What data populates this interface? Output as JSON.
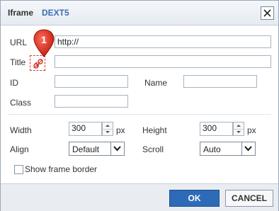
{
  "dialog": {
    "title": "Iframe",
    "brand": "DEXT5"
  },
  "fields": {
    "url_label": "URL",
    "url_value": "http://",
    "title_label": "Title",
    "title_value": "",
    "id_label": "ID",
    "id_value": "",
    "name_label": "Name",
    "name_value": "",
    "class_label": "Class",
    "class_value": ""
  },
  "layout_fields": {
    "width_label": "Width",
    "width_value": "300",
    "width_unit": "px",
    "height_label": "Height",
    "height_value": "300",
    "height_unit": "px",
    "align_label": "Align",
    "align_value": "Default",
    "scroll_label": "Scroll",
    "scroll_value": "Auto",
    "border_checkbox_label": "Show frame border",
    "border_checked": false
  },
  "buttons": {
    "ok": "OK",
    "cancel": "CANCEL"
  },
  "annotation": {
    "badge_number": "1"
  },
  "colors": {
    "accent": "#2d6bb8",
    "brand": "#3b6fb2",
    "badge": "#d9291c"
  },
  "icons": {
    "close": "close-icon",
    "link": "link-icon",
    "spinner": "spinner-icon",
    "dropdown": "chevron-down-icon"
  }
}
